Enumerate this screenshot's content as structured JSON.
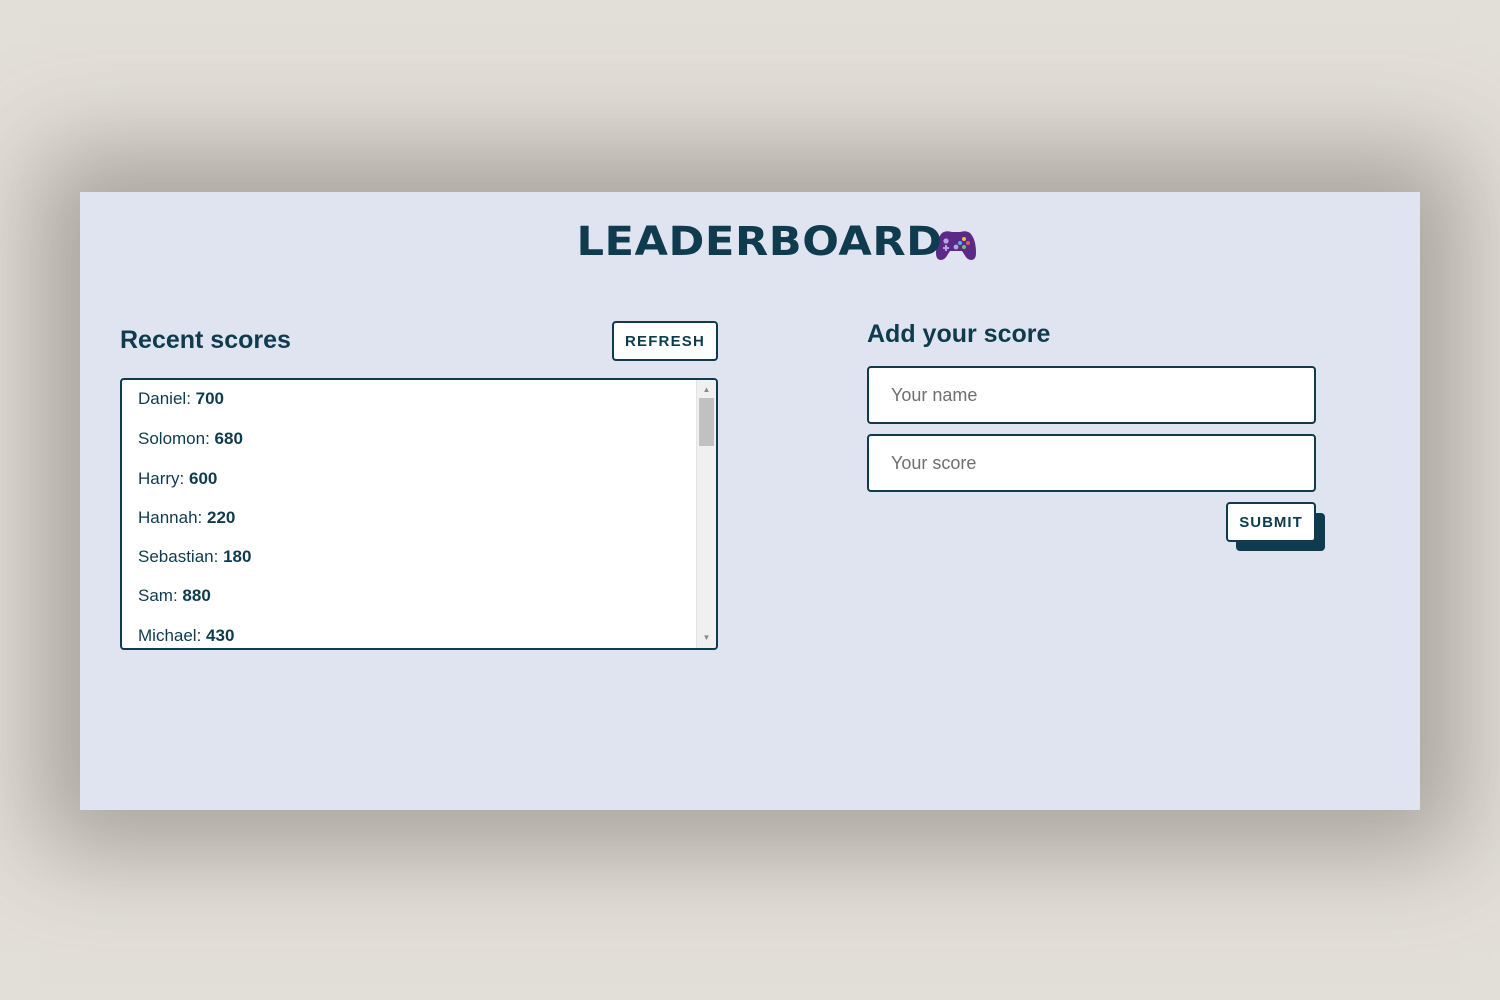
{
  "header": {
    "title": "LEADERBOARD",
    "icon": "gamepad-icon"
  },
  "recent_scores": {
    "heading": "Recent scores",
    "refresh_label": "REFRESH",
    "entries": [
      {
        "name": "Daniel: ",
        "score": "700"
      },
      {
        "name": "Solomon: ",
        "score": "680"
      },
      {
        "name": "Harry: ",
        "score": "600"
      },
      {
        "name": "Hannah: ",
        "score": "220"
      },
      {
        "name": "Sebastian: ",
        "score": "180"
      },
      {
        "name": "Sam: ",
        "score": "880"
      },
      {
        "name": "Michael: ",
        "score": "430"
      }
    ]
  },
  "add_score": {
    "heading": "Add your score",
    "name_placeholder": "Your name",
    "score_placeholder": "Your score",
    "submit_label": "SUBMIT"
  },
  "colors": {
    "accent": "#0e3b4d",
    "panel_background": "#e0e4f0",
    "page_background": "#e2dfd8",
    "gamepad": "#5b2a86"
  }
}
